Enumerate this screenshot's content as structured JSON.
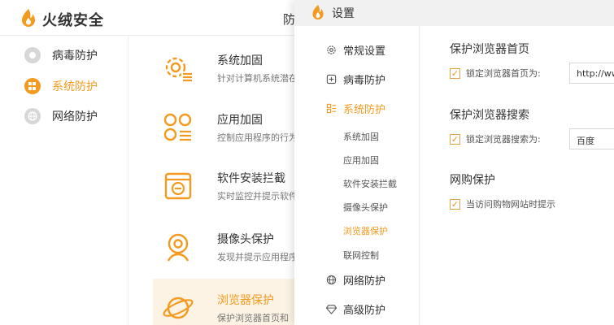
{
  "back_window": {
    "brand": "火绒安全",
    "title_fragment": "防",
    "nav": [
      {
        "label": "病毒防护",
        "icon": "shield-disc-icon"
      },
      {
        "label": "系统防护",
        "icon": "windows-icon"
      },
      {
        "label": "网络防护",
        "icon": "globe-icon"
      }
    ],
    "features": [
      {
        "name": "系统加固",
        "desc": "针对计算机系统潜在",
        "icon": "gear-list-icon"
      },
      {
        "name": "应用加固",
        "desc": "控制应用程序的行为",
        "icon": "apps-list-icon"
      },
      {
        "name": "软件安装拦截",
        "desc": "实时监控并提示软件",
        "icon": "install-box-icon"
      },
      {
        "name": "摄像头保护",
        "desc": "发现并提示应用程序",
        "icon": "webcam-icon"
      },
      {
        "name": "浏览器保护",
        "desc": "保护浏览器首页和",
        "icon": "planet-icon"
      }
    ]
  },
  "front_window": {
    "title": "设置",
    "sidebar": [
      {
        "label": "常规设置",
        "icon": "gear-icon"
      },
      {
        "label": "病毒防护",
        "icon": "plus-box-icon"
      },
      {
        "label": "系统防护",
        "icon": "grid-icon"
      },
      {
        "label": "网络防护",
        "icon": "globe-icon"
      },
      {
        "label": "高级防护",
        "icon": "diamond-icon"
      }
    ],
    "sub_items": [
      "系统加固",
      "应用加固",
      "软件安装拦截",
      "摄像头保护",
      "浏览器保护",
      "联网控制"
    ],
    "sections": [
      {
        "title": "保护浏览器首页",
        "option": "锁定浏览器首页为:",
        "checked": true,
        "input_value": "http://ww"
      },
      {
        "title": "保护浏览器搜索",
        "option": "锁定浏览器搜索为:",
        "checked": true,
        "input_value": "百度"
      },
      {
        "title": "网购保护",
        "option": "当访问购物网站时提示",
        "checked": true
      }
    ]
  },
  "colors": {
    "accent": "#f39a1f",
    "highlight_bg": "#fdf3e5"
  }
}
